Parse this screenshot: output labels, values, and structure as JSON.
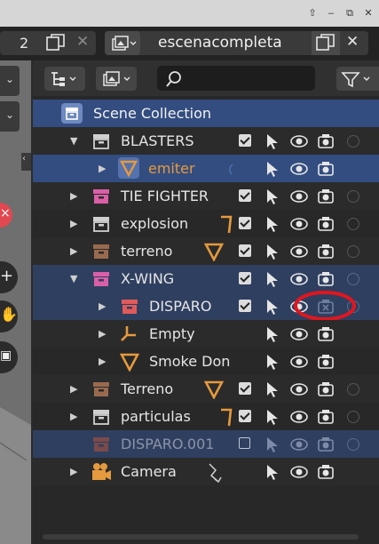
{
  "window": {
    "controls": [
      "⇧",
      "‒",
      "⧉",
      "✕"
    ]
  },
  "header": {
    "scene_number": "2",
    "scene_name": "escenacompleta"
  },
  "outliner": {
    "search_placeholder": "",
    "rows": [
      {
        "name": "Scene Collection",
        "kind": "scene"
      },
      {
        "name": "BLASTERS",
        "kind": "collection",
        "color": "#cfcfcf"
      },
      {
        "name": "emiter",
        "kind": "emitter",
        "label_color": "#e59a3d"
      },
      {
        "name": "TIE FIGHTER",
        "kind": "collection",
        "color": "#d95fa7"
      },
      {
        "name": "explosion",
        "kind": "collection",
        "color": "#cfcfcf"
      },
      {
        "name": "terreno",
        "kind": "collection",
        "color": "#9a6a4f"
      },
      {
        "name": "X-WING",
        "kind": "collection",
        "color": "#d95fa7"
      },
      {
        "name": "DISPARO",
        "kind": "collection",
        "color": "#e05a5a"
      },
      {
        "name": "Empty",
        "kind": "empty"
      },
      {
        "name": "Smoke Don",
        "kind": "mesh"
      },
      {
        "name": "Terreno",
        "kind": "collection",
        "color": "#9a6a4f"
      },
      {
        "name": "particulas",
        "kind": "collection",
        "color": "#cfcfcf"
      },
      {
        "name": "DISPARO.001",
        "kind": "collection-excluded",
        "color": "#7a4a4a"
      },
      {
        "name": "Camera",
        "kind": "camera"
      }
    ]
  },
  "colors": {
    "accent_selected": "#334d80",
    "annotation_red": "#e0161f",
    "orange": "#e59a3d"
  }
}
